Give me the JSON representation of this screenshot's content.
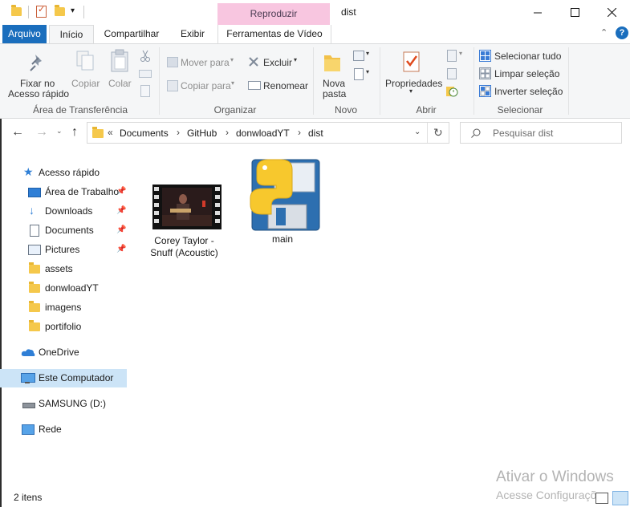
{
  "window": {
    "title": "dist",
    "context_tab": "Reproduzir",
    "context_color": "#f8c6e0",
    "accent": "#1a6ebd"
  },
  "tabs": [
    "Arquivo",
    "Início",
    "Compartilhar",
    "Exibir",
    "Ferramentas de Vídeo"
  ],
  "ribbon": {
    "clipboard": {
      "pin": "Fixar no\nAcesso rápido",
      "pin_1": "Fixar no",
      "pin_2": "Acesso rápido",
      "copy": "Copiar",
      "paste": "Colar",
      "title": "Área de Transferência"
    },
    "organize": {
      "move": "Mover para",
      "copy_to": "Copiar para",
      "delete": "Excluir",
      "rename": "Renomear",
      "title": "Organizar"
    },
    "new": {
      "new_folder_1": "Nova",
      "new_folder_2": "pasta",
      "title": "Novo"
    },
    "open": {
      "properties": "Propriedades",
      "title": "Abrir"
    },
    "select": {
      "all": "Selecionar tudo",
      "none": "Limpar seleção",
      "invert": "Inverter seleção",
      "title": "Selecionar"
    }
  },
  "address": {
    "overflow": "«",
    "crumbs": [
      "Documents",
      "GitHub",
      "donwloadYT",
      "dist"
    ]
  },
  "search": {
    "placeholder": "Pesquisar dist"
  },
  "nav": {
    "quick_access": "Acesso rápido",
    "items": [
      "Área de Trabalho",
      "Downloads",
      "Documents",
      "Pictures",
      "assets",
      "donwloadYT",
      "imagens",
      "portifolio"
    ],
    "onedrive": "OneDrive",
    "this_pc": "Este Computador",
    "drive": "SAMSUNG (D:)",
    "network": "Rede"
  },
  "files": [
    {
      "name_1": "Corey Taylor -",
      "name_2": "Snuff (Acoustic)",
      "icon": "video-file-icon"
    },
    {
      "name_1": "main",
      "icon": "python-exe-icon"
    }
  ],
  "status": {
    "count": "2 itens"
  },
  "watermark": {
    "line1": "Ativar o Windows",
    "line2": "Acesse Configurações"
  }
}
